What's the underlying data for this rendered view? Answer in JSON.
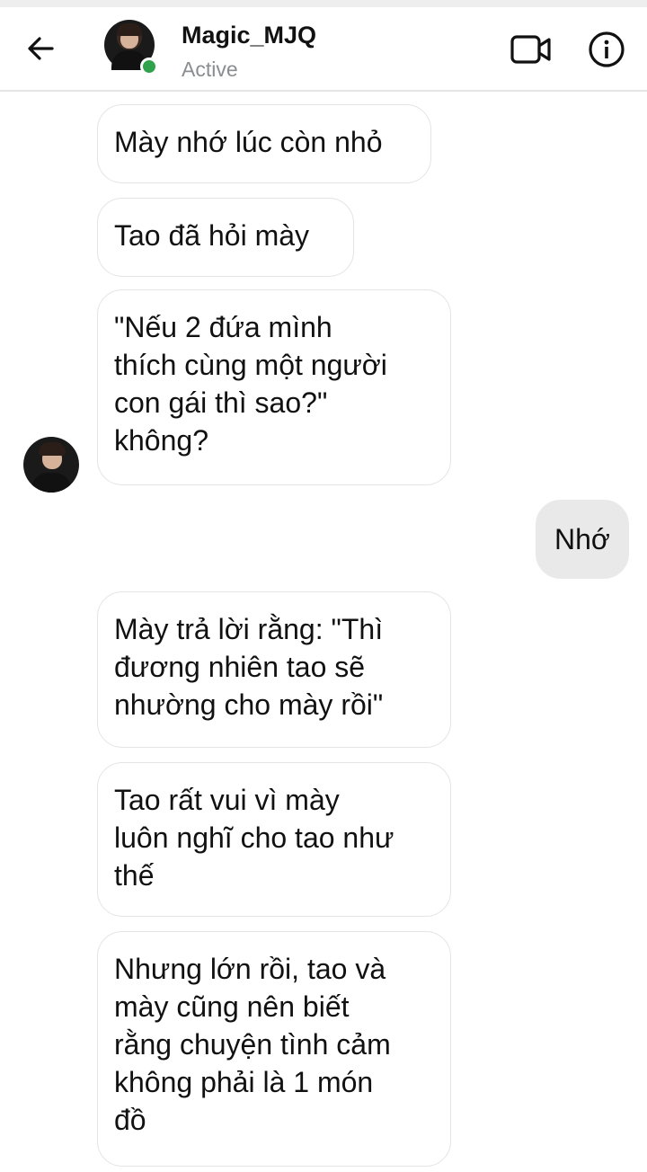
{
  "header": {
    "contact_name": "Magic_MJQ",
    "status": "Active",
    "icons": {
      "back": "back-arrow-icon",
      "video": "video-call-icon",
      "info": "info-icon"
    },
    "active_color": "#31a24c"
  },
  "messages": [
    {
      "sender": "contact",
      "text": "Mày nhớ lúc còn nhỏ"
    },
    {
      "sender": "contact",
      "text": "Tao đã hỏi mày"
    },
    {
      "sender": "contact",
      "text": "\"Nếu 2 đứa mình\nthích cùng một người\ncon gái thì sao?\"\nkhông?"
    },
    {
      "sender": "me",
      "text": "Nhớ"
    },
    {
      "sender": "contact",
      "text": "Mày trả lời rằng: \"Thì\nđương nhiên tao sẽ\nnhường cho mày rồi\""
    },
    {
      "sender": "contact",
      "text": "Tao rất vui vì mày\nluôn nghĩ cho tao như\nthế"
    },
    {
      "sender": "contact",
      "text": "Nhưng lớn rồi, tao và\nmày cũng nên biết\nrằng chuyện tình cảm\nkhông phải là 1 món\nđồ"
    }
  ]
}
